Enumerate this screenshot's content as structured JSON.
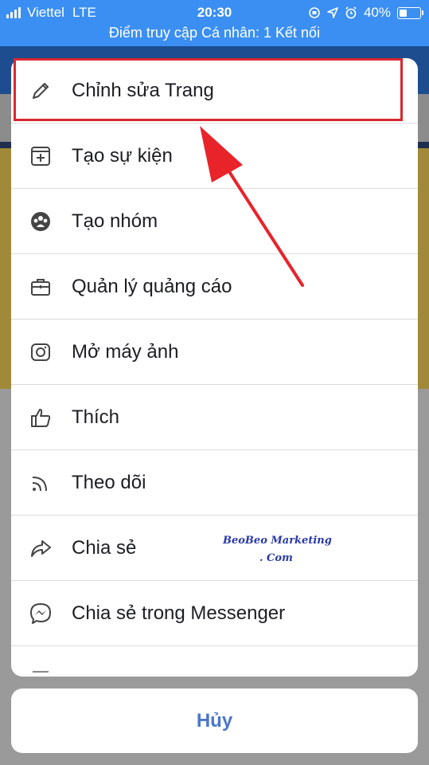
{
  "status_bar": {
    "carrier": "Viettel",
    "network": "LTE",
    "time": "20:30",
    "battery": "40%",
    "battery_level": 0.4,
    "hotspot_text": "Điểm truy cập Cá nhân: 1 Kết nối"
  },
  "menu": {
    "items": [
      {
        "label": "Chỉnh sửa Trang",
        "icon": "pencil-icon"
      },
      {
        "label": "Tạo sự kiện",
        "icon": "calendar-plus-icon"
      },
      {
        "label": "Tạo nhóm",
        "icon": "group-icon"
      },
      {
        "label": "Quản lý quảng cáo",
        "icon": "briefcase-icon"
      },
      {
        "label": "Mở máy ảnh",
        "icon": "camera-icon"
      },
      {
        "label": "Thích",
        "icon": "thumbs-up-icon"
      },
      {
        "label": "Theo dõi",
        "icon": "rss-icon"
      },
      {
        "label": "Chia sẻ",
        "icon": "share-icon"
      },
      {
        "label": "Chia sẻ trong Messenger",
        "icon": "messenger-icon"
      }
    ]
  },
  "cancel_label": "Hủy",
  "watermark": {
    "line1": "BeoBeo Marketing",
    "line2": ". Com"
  },
  "colors": {
    "status_bar": "#3b8ff2",
    "highlight": "#d8282e",
    "arrow": "#e8232a",
    "cancel_text": "#4a76c9"
  }
}
